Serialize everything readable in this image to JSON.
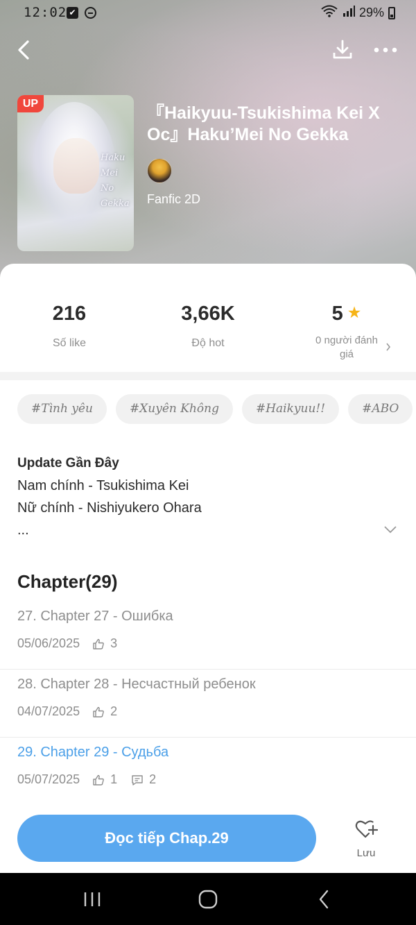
{
  "status_bar": {
    "time": "12:02",
    "battery": "29%",
    "check_glyph": "✔"
  },
  "header": {
    "up_badge": "UP",
    "cover_text": "Haku Mei No Gekka",
    "title": "『Haikyuu-Tsukishima Kei X Oc』Haku’Mei No Gekka",
    "genre": "Fanfic 2D"
  },
  "stats": {
    "likes_value": "216",
    "likes_label": "Số like",
    "hot_value": "3,66K",
    "hot_label": "Độ hot",
    "rating_value": "5",
    "rating_label": "0 người đánh giá"
  },
  "tags": [
    "#Tình yêu",
    "#Xuyên Không",
    "#Haikyuu!!",
    "#ABO"
  ],
  "description": {
    "title": "Update Gần Đây",
    "line1": "Nam chính - Tsukishima Kei",
    "line2": "Nữ chính - Nishiyukero Ohara",
    "line3": "..."
  },
  "chapters_title": "Chapter(29)",
  "chapters": [
    {
      "name": "27. Chapter 27 - Ошибка",
      "date": "05/06/2025",
      "likes": "3"
    },
    {
      "name": "28. Chapter 28 - Несчастный ребенок",
      "date": "04/07/2025",
      "likes": "2"
    },
    {
      "name": "29. Chapter 29 - Судьба",
      "date": "05/07/2025",
      "likes": "1",
      "comments": "2"
    }
  ],
  "actions": {
    "read_label": "Đọc tiếp Chap.29",
    "save_label": "Lưu"
  },
  "colors": {
    "accent": "#5aa8ef",
    "current_chapter": "#4a9fe8",
    "badge": "#f0473c",
    "star": "#f6b417"
  },
  "icons": {
    "back": "chevron-left-icon",
    "download": "download-icon",
    "more": "more-dots-icon",
    "star": "star-icon",
    "like": "thumbs-up-icon",
    "comment": "comment-icon",
    "save": "heart-plus-icon"
  }
}
